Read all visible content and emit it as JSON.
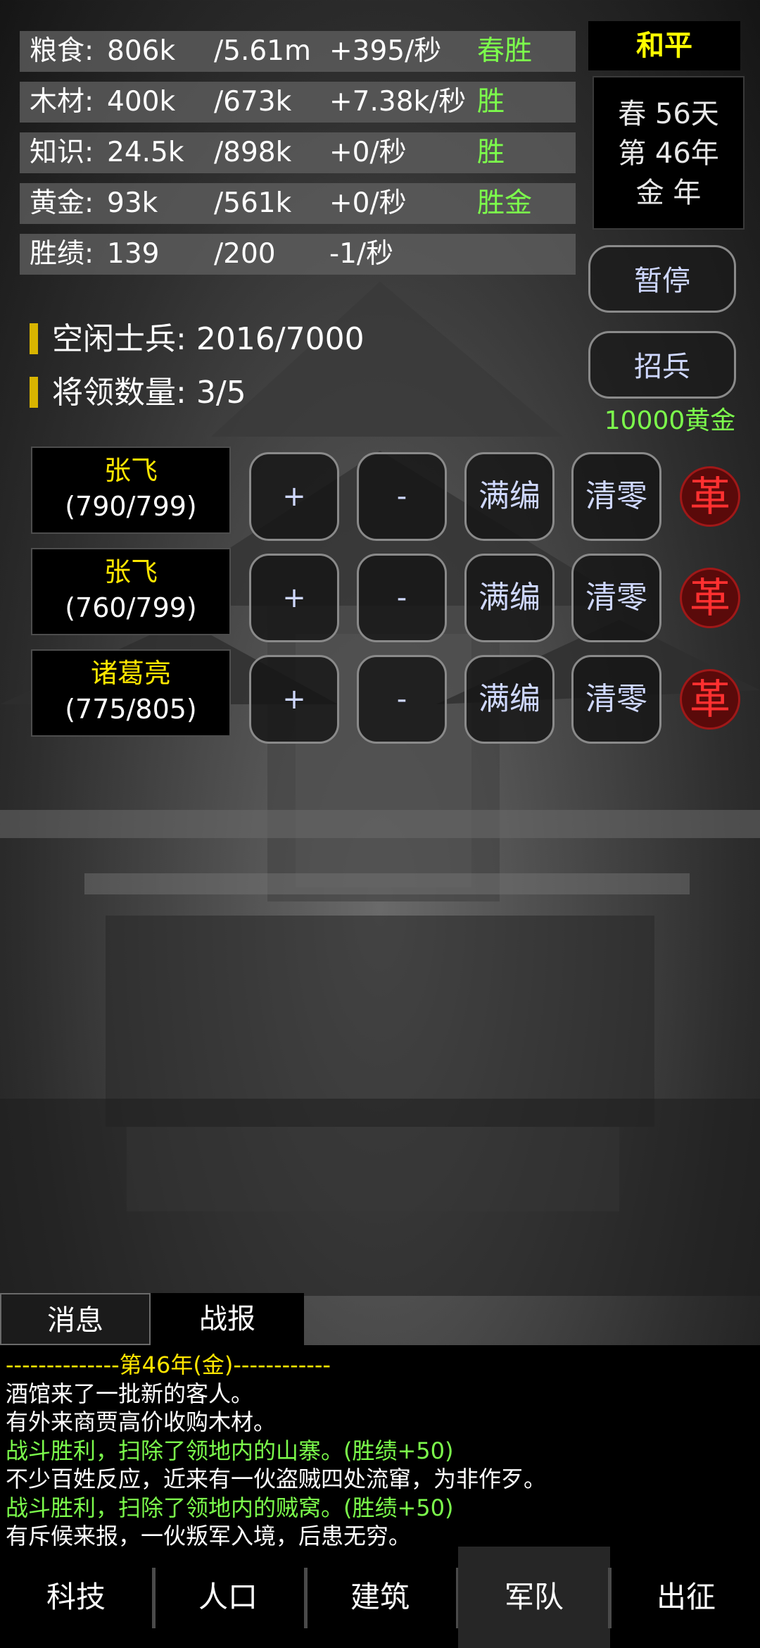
{
  "resources": [
    {
      "name": "粮食:",
      "current": "806k",
      "cap": "/5.61m",
      "rate": "+395/秒",
      "tag": "春胜"
    },
    {
      "name": "木材:",
      "current": "400k",
      "cap": "/673k",
      "rate": "+7.38k/秒",
      "tag": "胜"
    },
    {
      "name": "知识:",
      "current": "24.5k",
      "cap": "/898k",
      "rate": "+0/秒",
      "tag": "胜"
    },
    {
      "name": "黄金:",
      "current": "93k",
      "cap": "/561k",
      "rate": "+0/秒",
      "tag": "胜金"
    },
    {
      "name": "胜绩:",
      "current": "139",
      "cap": "/200",
      "rate": "-1/秒",
      "tag": ""
    }
  ],
  "status": {
    "peace": "和平",
    "season_day": "春 56天",
    "year": "第 46年",
    "element_year": "金 年"
  },
  "actions": {
    "pause": "暂停",
    "recruit": "招兵",
    "recruit_cost": "10000黄金"
  },
  "army": {
    "idle_label": "空闲士兵:",
    "idle_value": "2016/7000",
    "generals_label": "将领数量:",
    "generals_value": "3/5"
  },
  "generals": [
    {
      "name": "张飞",
      "troops": "(790/799)"
    },
    {
      "name": "张飞",
      "troops": "(760/799)"
    },
    {
      "name": "诸葛亮",
      "troops": "(775/805)"
    }
  ],
  "general_controls": {
    "plus": "+",
    "minus": "-",
    "fill": "满编",
    "clear": "清零",
    "dismiss": "革"
  },
  "log_tabs": {
    "messages": "消息",
    "battle": "战报"
  },
  "log_lines": [
    {
      "text": "--------------第46年(金)------------",
      "kind": "hdr"
    },
    {
      "text": "酒馆来了一批新的客人。",
      "kind": "w"
    },
    {
      "text": "有外来商贾高价收购木材。",
      "kind": "w"
    },
    {
      "text": "战斗胜利，扫除了领地内的山寨。(胜绩+50)",
      "kind": "g"
    },
    {
      "text": "不少百姓反应，近来有一伙盗贼四处流窜，为非作歹。",
      "kind": "w"
    },
    {
      "text": "战斗胜利，扫除了领地内的贼窝。(胜绩+50)",
      "kind": "g"
    },
    {
      "text": "有斥候来报，一伙叛军入境，后患无穷。",
      "kind": "w"
    }
  ],
  "nav": [
    "科技",
    "人口",
    "建筑",
    "军队",
    "出征"
  ],
  "nav_active": "军队",
  "colors": {
    "green": "#7CFC4C",
    "yellow": "#ffe600",
    "red": "#ff3030"
  }
}
